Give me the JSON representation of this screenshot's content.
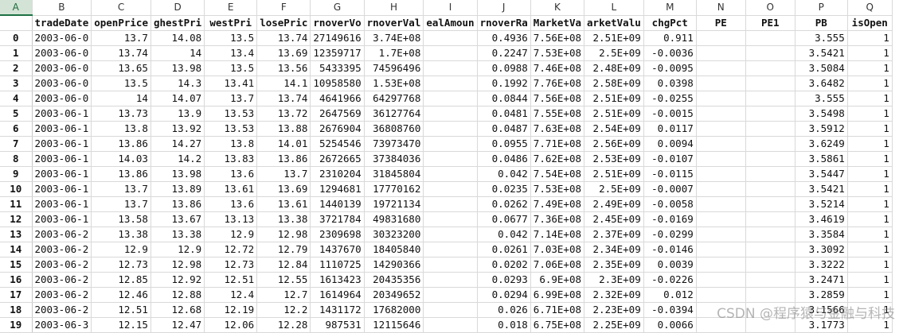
{
  "columns": [
    "A",
    "B",
    "C",
    "D",
    "E",
    "F",
    "G",
    "H",
    "I",
    "J",
    "K",
    "L",
    "M",
    "N",
    "O",
    "P",
    "Q"
  ],
  "header_row": [
    "",
    "tradeDate",
    "openPrice",
    "highestPrice",
    "lowestPrice",
    "closePrice",
    "turnoverVol",
    "turnoverValue",
    "dealAmount",
    "turnoverRate",
    "negMarketValue",
    "marketValue",
    "chgPct",
    "PE",
    "PE1",
    "PB",
    "isOpen"
  ],
  "header_display": [
    "",
    "tradeDate",
    "openPrice",
    "ghestPri",
    "westPri",
    "losePric",
    "rnoverVo",
    "rnoverVal",
    "ealAmoun",
    "rnoverRa",
    "MarketVa",
    "arketValu",
    "chgPct",
    "PE",
    "PE1",
    "PB",
    "isOpen"
  ],
  "rows": [
    {
      "idx": "0",
      "cells": [
        "2003-06-0",
        "13.7",
        "14.08",
        "13.5",
        "13.74",
        "27149616",
        "3.74E+08",
        "",
        "0.4936",
        "7.56E+08",
        "2.51E+09",
        "0.911",
        "",
        "",
        "3.555",
        "1"
      ]
    },
    {
      "idx": "1",
      "cells": [
        "2003-06-0",
        "13.74",
        "14",
        "13.4",
        "13.69",
        "12359717",
        "1.7E+08",
        "",
        "0.2247",
        "7.53E+08",
        "2.5E+09",
        "-0.0036",
        "",
        "",
        "3.5421",
        "1"
      ]
    },
    {
      "idx": "2",
      "cells": [
        "2003-06-0",
        "13.65",
        "13.98",
        "13.5",
        "13.56",
        "5433395",
        "74596496",
        "",
        "0.0988",
        "7.46E+08",
        "2.48E+09",
        "-0.0095",
        "",
        "",
        "3.5084",
        "1"
      ]
    },
    {
      "idx": "3",
      "cells": [
        "2003-06-0",
        "13.5",
        "14.3",
        "13.41",
        "14.1",
        "10958580",
        "1.53E+08",
        "",
        "0.1992",
        "7.76E+08",
        "2.58E+09",
        "0.0398",
        "",
        "",
        "3.6482",
        "1"
      ]
    },
    {
      "idx": "4",
      "cells": [
        "2003-06-0",
        "14",
        "14.07",
        "13.7",
        "13.74",
        "4641966",
        "64297768",
        "",
        "0.0844",
        "7.56E+08",
        "2.51E+09",
        "-0.0255",
        "",
        "",
        "3.555",
        "1"
      ]
    },
    {
      "idx": "5",
      "cells": [
        "2003-06-1",
        "13.73",
        "13.9",
        "13.53",
        "13.72",
        "2647569",
        "36127764",
        "",
        "0.0481",
        "7.55E+08",
        "2.51E+09",
        "-0.0015",
        "",
        "",
        "3.5498",
        "1"
      ]
    },
    {
      "idx": "6",
      "cells": [
        "2003-06-1",
        "13.8",
        "13.92",
        "13.53",
        "13.88",
        "2676904",
        "36808760",
        "",
        "0.0487",
        "7.63E+08",
        "2.54E+09",
        "0.0117",
        "",
        "",
        "3.5912",
        "1"
      ]
    },
    {
      "idx": "7",
      "cells": [
        "2003-06-1",
        "13.86",
        "14.27",
        "13.8",
        "14.01",
        "5254546",
        "73973470",
        "",
        "0.0955",
        "7.71E+08",
        "2.56E+09",
        "0.0094",
        "",
        "",
        "3.6249",
        "1"
      ]
    },
    {
      "idx": "8",
      "cells": [
        "2003-06-1",
        "14.03",
        "14.2",
        "13.83",
        "13.86",
        "2672665",
        "37384036",
        "",
        "0.0486",
        "7.62E+08",
        "2.53E+09",
        "-0.0107",
        "",
        "",
        "3.5861",
        "1"
      ]
    },
    {
      "idx": "9",
      "cells": [
        "2003-06-1",
        "13.86",
        "13.98",
        "13.6",
        "13.7",
        "2310204",
        "31845804",
        "",
        "0.042",
        "7.54E+08",
        "2.51E+09",
        "-0.0115",
        "",
        "",
        "3.5447",
        "1"
      ]
    },
    {
      "idx": "10",
      "cells": [
        "2003-06-1",
        "13.7",
        "13.89",
        "13.61",
        "13.69",
        "1294681",
        "17770162",
        "",
        "0.0235",
        "7.53E+08",
        "2.5E+09",
        "-0.0007",
        "",
        "",
        "3.5421",
        "1"
      ]
    },
    {
      "idx": "11",
      "cells": [
        "2003-06-1",
        "13.7",
        "13.86",
        "13.6",
        "13.61",
        "1440139",
        "19721134",
        "",
        "0.0262",
        "7.49E+08",
        "2.49E+09",
        "-0.0058",
        "",
        "",
        "3.5214",
        "1"
      ]
    },
    {
      "idx": "12",
      "cells": [
        "2003-06-1",
        "13.58",
        "13.67",
        "13.13",
        "13.38",
        "3721784",
        "49831680",
        "",
        "0.0677",
        "7.36E+08",
        "2.45E+09",
        "-0.0169",
        "",
        "",
        "3.4619",
        "1"
      ]
    },
    {
      "idx": "13",
      "cells": [
        "2003-06-2",
        "13.38",
        "13.38",
        "12.9",
        "12.98",
        "2309698",
        "30323200",
        "",
        "0.042",
        "7.14E+08",
        "2.37E+09",
        "-0.0299",
        "",
        "",
        "3.3584",
        "1"
      ]
    },
    {
      "idx": "14",
      "cells": [
        "2003-06-2",
        "12.9",
        "12.9",
        "12.72",
        "12.79",
        "1437670",
        "18405840",
        "",
        "0.0261",
        "7.03E+08",
        "2.34E+09",
        "-0.0146",
        "",
        "",
        "3.3092",
        "1"
      ]
    },
    {
      "idx": "15",
      "cells": [
        "2003-06-2",
        "12.73",
        "12.98",
        "12.73",
        "12.84",
        "1110725",
        "14290366",
        "",
        "0.0202",
        "7.06E+08",
        "2.35E+09",
        "0.0039",
        "",
        "",
        "3.3222",
        "1"
      ]
    },
    {
      "idx": "16",
      "cells": [
        "2003-06-2",
        "12.85",
        "12.92",
        "12.51",
        "12.55",
        "1613423",
        "20435356",
        "",
        "0.0293",
        "6.9E+08",
        "2.3E+09",
        "-0.0226",
        "",
        "",
        "3.2471",
        "1"
      ]
    },
    {
      "idx": "17",
      "cells": [
        "2003-06-2",
        "12.46",
        "12.88",
        "12.4",
        "12.7",
        "1614964",
        "20349652",
        "",
        "0.0294",
        "6.99E+08",
        "2.32E+09",
        "0.012",
        "",
        "",
        "3.2859",
        "1"
      ]
    },
    {
      "idx": "18",
      "cells": [
        "2003-06-2",
        "12.51",
        "12.68",
        "12.19",
        "12.2",
        "1431172",
        "17682000",
        "",
        "0.026",
        "6.71E+08",
        "2.23E+09",
        "-0.0394",
        "",
        "",
        "3.1566",
        "1"
      ]
    },
    {
      "idx": "19",
      "cells": [
        "2003-06-3",
        "12.15",
        "12.47",
        "12.06",
        "12.28",
        "987531",
        "12115646",
        "",
        "0.018",
        "6.75E+08",
        "2.25E+09",
        "0.0066",
        "",
        "",
        "3.1773",
        "1"
      ]
    }
  ],
  "watermark": "CSDN @程序猿与金融与科技"
}
